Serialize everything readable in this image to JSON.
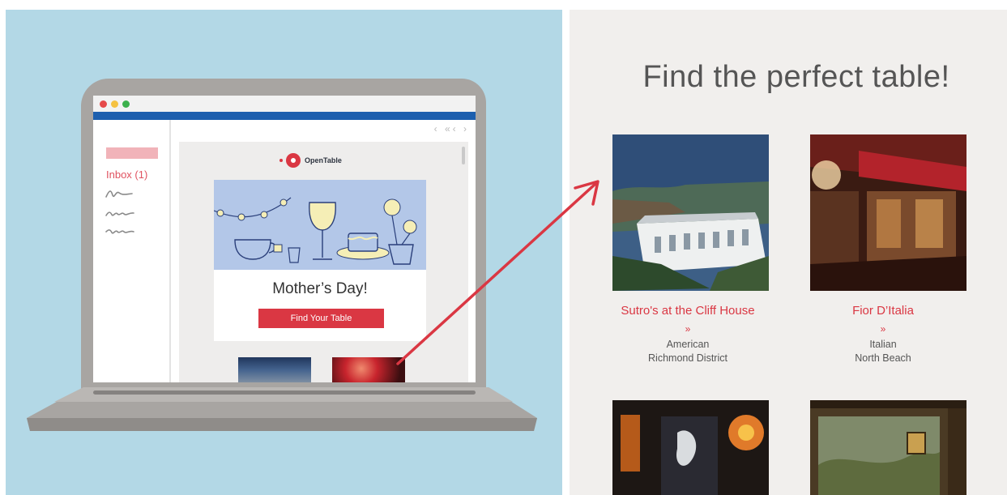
{
  "illustration": {
    "inbox_label": "Inbox (1)",
    "nav_arrows": "‹ «‹ ›",
    "brand_name": "OpenTable",
    "email_title": "Mother’s Day!",
    "email_button": "Find Your Table",
    "colors": {
      "background": "#b3d8e6",
      "brand_red": "#da3743",
      "mail_blue": "#1d5fae"
    },
    "window_dots": [
      "#e64a4a",
      "#f5c242",
      "#3bb04c"
    ]
  },
  "main": {
    "heading": "Find the perfect table!",
    "restaurants": [
      {
        "name": "Sutro's at the Cliff House",
        "link_glyph": "»",
        "cuisine": "American",
        "neighborhood": "Richmond District"
      },
      {
        "name": "Fior D’Italia",
        "link_glyph": "»",
        "cuisine": "Italian",
        "neighborhood": "North Beach"
      }
    ]
  }
}
